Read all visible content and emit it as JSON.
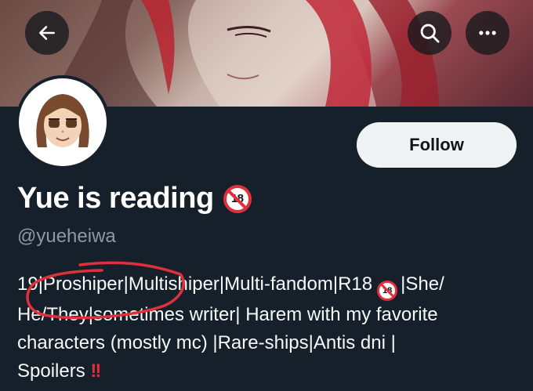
{
  "header": {
    "back_icon": "arrow-left-icon",
    "search_icon": "search-icon",
    "more_icon": "more-horizontal-icon"
  },
  "profile": {
    "display_name": "Yue is reading",
    "name_badge": "18",
    "handle": "@yueheiwa",
    "follow_label": "Follow",
    "avatar_icon": "cartoon-avatar-icon"
  },
  "bio": {
    "line1_a": "19|Proshiper|Multishiper|Multi-fandom|R18",
    "line1_badge": "18",
    "line1_b": "|She/",
    "line2": "He/They|sometimes writer| Harem with my favorite",
    "line3": "characters (mostly mc) |Rare-ships|Antis dni |",
    "line4": "Spoilers",
    "line4_emoji": "!!"
  },
  "colors": {
    "background": "#15202b",
    "follow_bg": "#eff3f4",
    "handle_gray": "#8b98a5",
    "annotation_red": "#e0303b"
  }
}
